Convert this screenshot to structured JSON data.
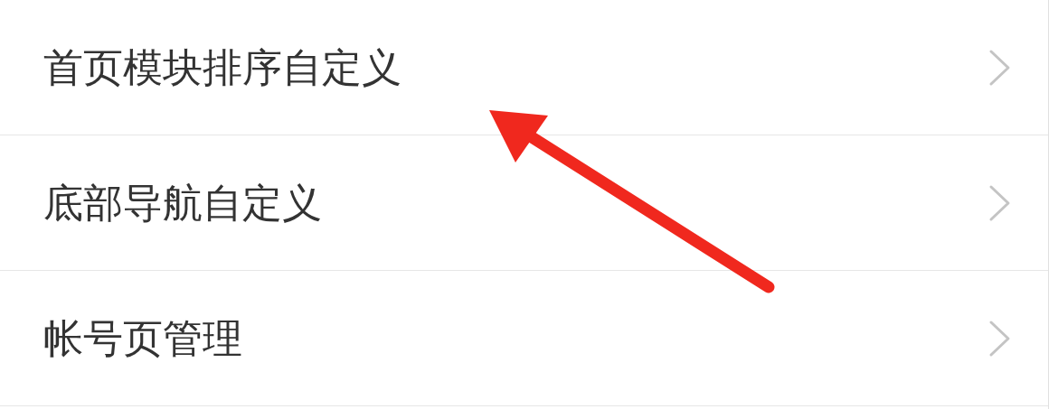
{
  "rows": [
    {
      "label": "首页模块排序自定义"
    },
    {
      "label": "底部导航自定义"
    },
    {
      "label": "帐号页管理"
    }
  ],
  "annotation": {
    "kind": "arrow",
    "color": "#f0281e"
  }
}
